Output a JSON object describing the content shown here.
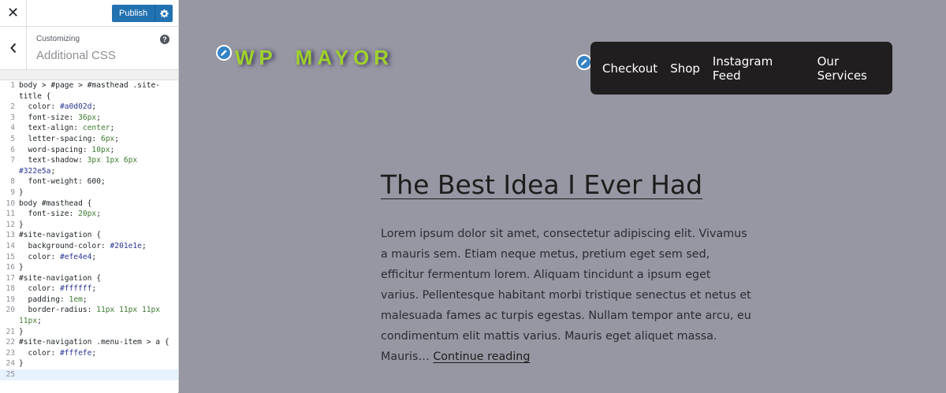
{
  "topbar": {
    "close_icon": "close-icon",
    "publish_label": "Publish",
    "settings_icon": "gear-icon"
  },
  "section": {
    "back_icon": "chevron-left-icon",
    "customizing": "Customizing",
    "title": "Additional CSS",
    "help_icon": "help-icon"
  },
  "editor": {
    "lines": [
      {
        "n": "1",
        "text": "body > #page > #masthead .site-"
      },
      {
        "n": "",
        "text": "title {"
      },
      {
        "n": "2",
        "text": "  color: #a0d02d;"
      },
      {
        "n": "3",
        "text": "  font-size: 36px;"
      },
      {
        "n": "4",
        "text": "  text-align: center;"
      },
      {
        "n": "5",
        "text": "  letter-spacing: 6px;"
      },
      {
        "n": "6",
        "text": "  word-spacing: 10px;"
      },
      {
        "n": "7",
        "text": "  text-shadow: 3px 1px 6px"
      },
      {
        "n": "",
        "text": "#322e5a;"
      },
      {
        "n": "8",
        "text": "  font-weight: 600;"
      },
      {
        "n": "9",
        "text": "}"
      },
      {
        "n": "10",
        "text": "body #masthead {"
      },
      {
        "n": "11",
        "text": "  font-size: 20px;"
      },
      {
        "n": "12",
        "text": "}"
      },
      {
        "n": "13",
        "text": "#site-navigation {"
      },
      {
        "n": "14",
        "text": "  background-color: #201e1e;"
      },
      {
        "n": "15",
        "text": "  color: #efe4e4;"
      },
      {
        "n": "16",
        "text": "}"
      },
      {
        "n": "17",
        "text": "#site-navigation {"
      },
      {
        "n": "18",
        "text": "  color: #ffffff;"
      },
      {
        "n": "19",
        "text": "  padding: 1em;"
      },
      {
        "n": "20",
        "text": "  border-radius: 11px 11px 11px"
      },
      {
        "n": "",
        "text": "11px;"
      },
      {
        "n": "21",
        "text": "}"
      },
      {
        "n": "22",
        "text": "#site-navigation .menu-item > a {"
      },
      {
        "n": "23",
        "text": "  color: #fffefe;"
      },
      {
        "n": "24",
        "text": "}"
      },
      {
        "n": "25",
        "text": ""
      }
    ]
  },
  "site": {
    "title": "WP MAYOR",
    "title_color": "#a0d02d",
    "nav_bg": "#201e1e",
    "nav": [
      "Checkout",
      "Shop",
      "Instagram Feed",
      "Our Services"
    ],
    "post_title": "The Best Idea I Ever Had",
    "excerpt": "Lorem ipsum dolor sit amet, consectetur adipiscing elit. Vivamus a mauris sem. Etiam neque metus, pretium eget sem sed, efficitur fermentum lorem. Aliquam tincidunt a ipsum eget varius. Pellentesque habitant morbi tristique senectus et netus et malesuada fames ac turpis egestas. Nullam tempor ante arcu, eu condimentum elit mattis varius. Mauris eget aliquet massa. Mauris…",
    "continue_label": "Continue reading"
  }
}
